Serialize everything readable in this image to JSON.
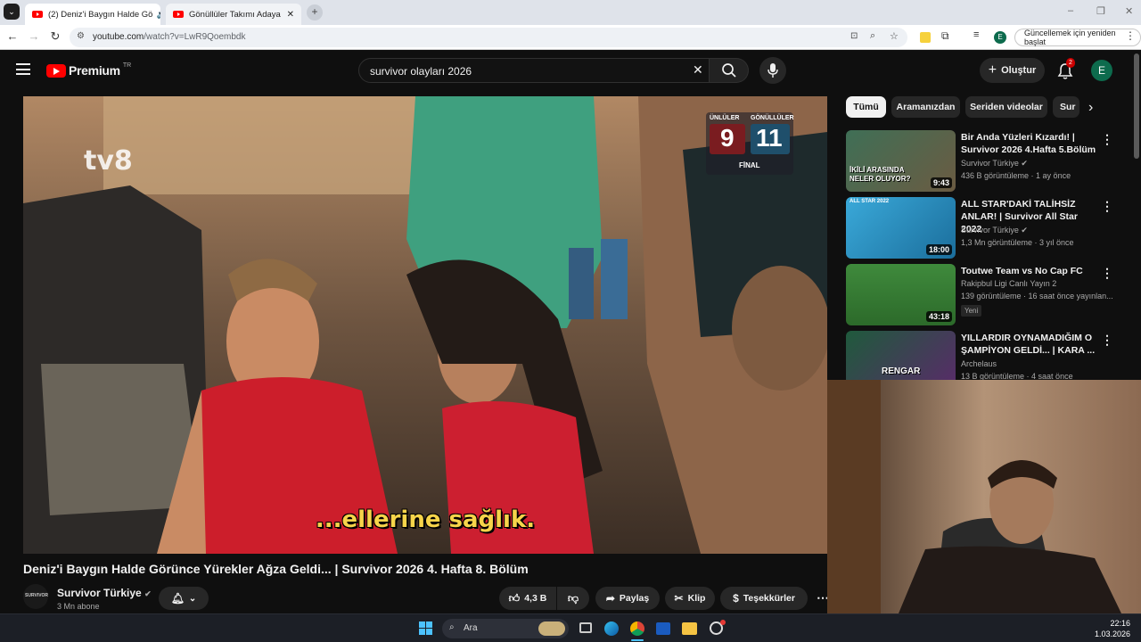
{
  "browser": {
    "tabs": [
      {
        "label": "(2) Deniz'i Baygın Halde Gö",
        "active": true
      },
      {
        "label": "Gönüllüler Takımı Adaya Uğurla",
        "active": false
      }
    ],
    "url_host": "youtube.com",
    "url_path": "/watch?v=LwR9Qoembdk",
    "update_label": "Güncellemek için yeniden başlat",
    "profile_initial": "E"
  },
  "header": {
    "logo_text": "Premium",
    "logo_sup": "TR",
    "search_value": "survivor olayları 2026",
    "create_label": "Oluştur",
    "notification_count": "2",
    "avatar_initial": "E"
  },
  "video": {
    "scoreboard": {
      "left_team": "ÜNLÜLER",
      "right_team": "GÖNÜLLÜLER",
      "left_score": "9",
      "right_score": "11",
      "stage": "FİNAL"
    },
    "channel_logo": "tv8",
    "subtitle": "...ellerine sağlık.",
    "title": "Deniz'i Baygın Halde Görünce Yürekler Ağza Geldi... | Survivor 2026 4. Hafta 8. Bölüm"
  },
  "channel": {
    "name": "Survivor Türkiye",
    "subscribers": "3 Mn abone",
    "avatar_text": "SURVIVOR"
  },
  "actions": {
    "likes": "4,3 B",
    "share": "Paylaş",
    "clip": "Klip",
    "thanks": "Teşekkürler"
  },
  "chips": [
    "Tümü",
    "Aramanızdan",
    "Seriden videolar",
    "Sur"
  ],
  "recommendations": [
    {
      "title": "Bir Anda Yüzleri Kızardı! | Survivor 2026 4.Hafta 5.Bölüm",
      "channel": "Survivor Türkiye",
      "verified": true,
      "meta": "436 B görüntüleme · 1 ay önce",
      "duration": "9:43",
      "thumb_text": "İKİLİ ARASINDA NELER OLUYOR?"
    },
    {
      "title": "ALL STAR'DAKİ TALİHSİZ ANLAR! | Survivor All Star 2022",
      "channel": "Survivor Türkiye",
      "verified": true,
      "meta": "1,3 Mn görüntüleme · 3 yıl önce",
      "duration": "18:00",
      "thumb_text": "ALL STAR 2022"
    },
    {
      "title": "Toutwe Team vs No Cap FC",
      "channel": "Rakipbul Ligi Canlı Yayın 2",
      "verified": false,
      "meta": "139 görüntüleme · 16 saat önce yayınlan...",
      "duration": "43:18",
      "badge": "Yeni"
    },
    {
      "title": "YILLARDIR OYNAMADIĞIM O ŞAMPİYON GELDİ... | KARA ...",
      "channel": "Archelaus",
      "verified": false,
      "meta": "13 B görüntüleme · 4 saat önce",
      "thumb_text": "RENGAR"
    }
  ],
  "taskbar": {
    "search_placeholder": "Ara",
    "time": "22:16",
    "date": "1.03.2026"
  }
}
